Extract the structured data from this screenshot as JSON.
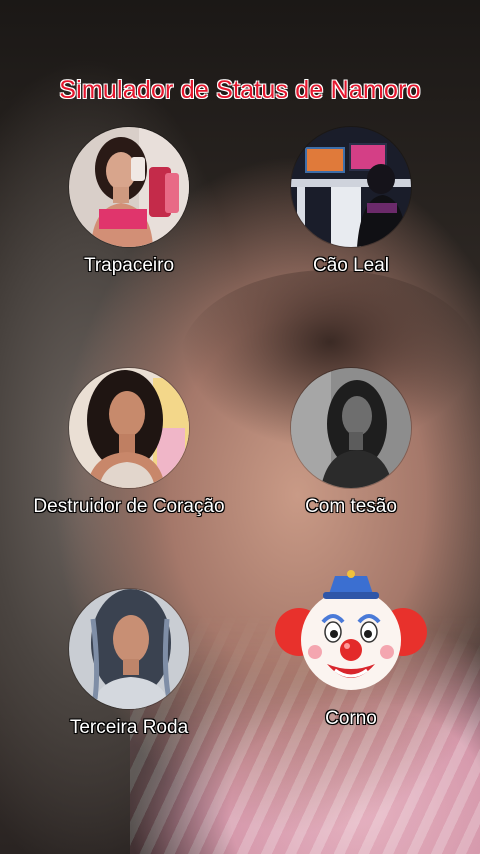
{
  "title": "Simulador de Status de Namoro",
  "options": [
    {
      "label": "Trapaceiro",
      "icon": "woman-pink-top-photo"
    },
    {
      "label": "Cão Leal",
      "icon": "gamer-desk-photo"
    },
    {
      "label": "Destruidor de Coração",
      "icon": "woman-curly-hair-photo"
    },
    {
      "label": "Com tesão",
      "icon": "woman-grayscale-photo"
    },
    {
      "label": "Terceira Roda",
      "icon": "woman-braids-photo"
    },
    {
      "label": "Corno",
      "icon": "clown-face-icon"
    }
  ],
  "colors": {
    "title": "#e4172e",
    "label": "#ffffff"
  }
}
